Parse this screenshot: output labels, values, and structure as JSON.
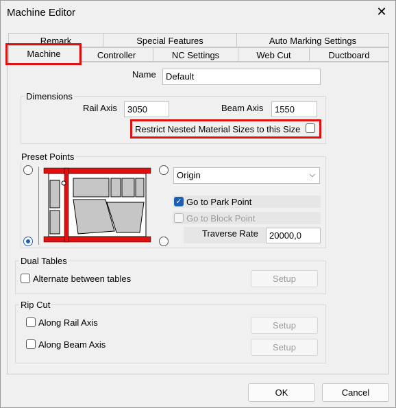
{
  "window": {
    "title": "Machine Editor"
  },
  "tabs": {
    "row_back": [
      "Remark",
      "Special Features",
      "Auto Marking Settings"
    ],
    "row_front": [
      "Machine",
      "Controller",
      "NC Settings",
      "Web Cut",
      "Ductboard"
    ]
  },
  "machine": {
    "name_label": "Name",
    "name_value": "Default",
    "dimensions": {
      "group_label": "Dimensions",
      "rail_label": "Rail Axis",
      "rail_value": "3050",
      "beam_label": "Beam Axis",
      "beam_value": "1550",
      "restrict_label": "Restrict Nested Material Sizes to this Size",
      "restrict_checked": false
    },
    "preset_points": {
      "group_label": "Preset Points",
      "point_select": "Origin",
      "park_label": "Go to Park Point",
      "park_checked": true,
      "block_label": "Go to Block Point",
      "block_checked": false,
      "traverse_label": "Traverse Rate",
      "traverse_value": "20000,0"
    },
    "dual_tables": {
      "group_label": "Dual Tables",
      "alternate_label": "Alternate between tables",
      "setup_label": "Setup"
    },
    "rip_cut": {
      "group_label": "Rip Cut",
      "rail_label": "Along Rail Axis",
      "rail_setup": "Setup",
      "beam_label": "Along Beam Axis",
      "beam_setup": "Setup"
    }
  },
  "footer": {
    "ok_label": "OK",
    "cancel_label": "Cancel"
  },
  "colors": {
    "highlight": "#e01010",
    "accent": "#1a5fb4"
  }
}
